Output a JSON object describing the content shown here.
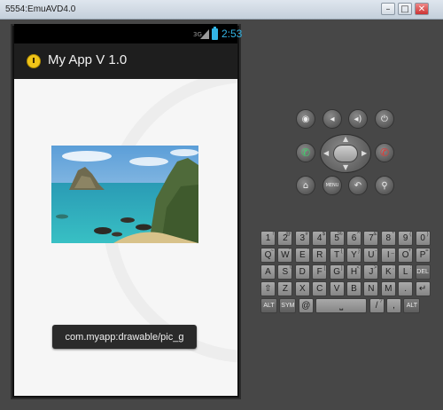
{
  "window": {
    "title": "5554:EmuAVD4.0",
    "minimize": "–",
    "maximize": "□",
    "close": "✕"
  },
  "status_bar": {
    "network": "3G",
    "time": "2:53",
    "battery_color": "#33b5e5"
  },
  "action_bar": {
    "title": "My App V 1.0",
    "icon": "clock-icon"
  },
  "toast": {
    "text": "com.myapp:drawable/pic_g"
  },
  "controls": {
    "camera": "◉",
    "volume_down": "◂",
    "volume_up": "◂)",
    "power": "⏻",
    "call": "✆",
    "end_call": "✆",
    "home": "⌂",
    "menu": "MENU",
    "back": "↶",
    "search": "⚲"
  },
  "keyboard": {
    "row1": [
      {
        "k": "1",
        "s": "!"
      },
      {
        "k": "2",
        "s": "@"
      },
      {
        "k": "3",
        "s": "#"
      },
      {
        "k": "4",
        "s": "$"
      },
      {
        "k": "5",
        "s": "%"
      },
      {
        "k": "6",
        "s": "^"
      },
      {
        "k": "7",
        "s": "&"
      },
      {
        "k": "8",
        "s": "*"
      },
      {
        "k": "9",
        "s": "("
      },
      {
        "k": "0",
        "s": ")"
      }
    ],
    "row2": [
      {
        "k": "Q",
        "s": "~"
      },
      {
        "k": "W",
        "s": "\""
      },
      {
        "k": "E",
        "s": "'"
      },
      {
        "k": "R",
        "s": ""
      },
      {
        "k": "T",
        "s": "{"
      },
      {
        "k": "Y",
        "s": "}"
      },
      {
        "k": "U",
        "s": "-"
      },
      {
        "k": "I",
        "s": "_"
      },
      {
        "k": "O",
        "s": "+"
      },
      {
        "k": "P",
        "s": "="
      }
    ],
    "row3": [
      {
        "k": "A",
        "s": ""
      },
      {
        "k": "S",
        "s": "\\"
      },
      {
        "k": "D",
        "s": ""
      },
      {
        "k": "F",
        "s": "["
      },
      {
        "k": "G",
        "s": "]"
      },
      {
        "k": "H",
        "s": "<"
      },
      {
        "k": "J",
        "s": ">"
      },
      {
        "k": "K",
        "s": ";"
      },
      {
        "k": "L",
        "s": ":"
      },
      {
        "k": "DEL",
        "s": ""
      }
    ],
    "row4": [
      {
        "k": "⇧",
        "s": ""
      },
      {
        "k": "Z",
        "s": ""
      },
      {
        "k": "X",
        "s": ""
      },
      {
        "k": "C",
        "s": ""
      },
      {
        "k": "V",
        "s": ""
      },
      {
        "k": "B",
        "s": ""
      },
      {
        "k": "N",
        "s": ""
      },
      {
        "k": "M",
        "s": ""
      },
      {
        "k": ".",
        "s": ""
      },
      {
        "k": "↵",
        "s": ""
      }
    ],
    "row5": [
      {
        "k": "ALT",
        "s": ""
      },
      {
        "k": "SYM",
        "s": ""
      },
      {
        "k": "@",
        "s": ""
      },
      {
        "k": "⎵",
        "s": ""
      },
      {
        "k": "/",
        "s": "?"
      },
      {
        "k": ",",
        "s": ""
      },
      {
        "k": "ALT",
        "s": ""
      }
    ]
  }
}
